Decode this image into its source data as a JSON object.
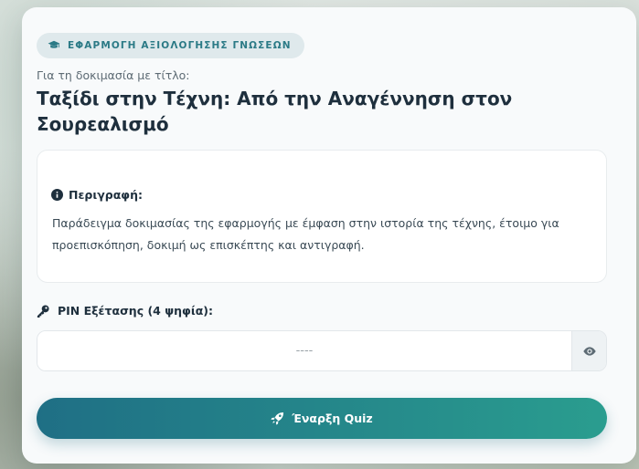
{
  "badge": {
    "icon": "graduation-cap-icon",
    "label": "ΕΦΑΡΜΟΓΗ ΑΞΙΟΛΟΓΗΣΗΣ ΓΝΩΣΕΩΝ"
  },
  "header": {
    "subtitle": "Για τη δοκιμασία με τίτλο:",
    "title": "Ταξίδι στην Τέχνη: Από την Αναγέννηση στον Σουρεαλισμό"
  },
  "description": {
    "icon": "info-circle-icon",
    "heading": "Περιγραφή:",
    "text": "Παράδειγμα δοκιμασίας της εφαρμογής με έμφαση στην ιστορία της τέχνης, έτοιμο για προεπισκόπηση, δοκιμή ως επισκέπτης και αντιγραφή."
  },
  "pin": {
    "icon": "key-icon",
    "label": "PIN Εξέτασης (4 ψηφία):",
    "value": "",
    "placeholder": "----",
    "toggle_icon": "eye-icon"
  },
  "start_button": {
    "icon": "rocket-icon",
    "label": "Έναρξη Quiz"
  },
  "colors": {
    "accent": "#2b7a86",
    "button_start": "#1f6f85",
    "button_end": "#2a9d8f",
    "title_text": "#1e2f3d"
  }
}
